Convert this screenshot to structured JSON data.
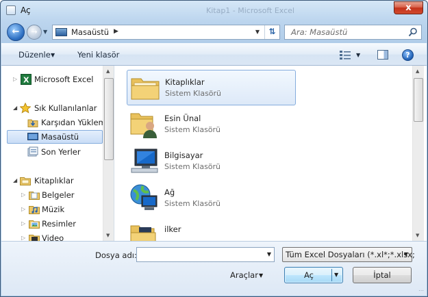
{
  "window": {
    "title": "Aç",
    "background_title": "Kitap1 - Microsoft Excel",
    "close_label": "x"
  },
  "nav": {
    "address": "Masaüstü",
    "search_placeholder": "Ara: Masaüstü"
  },
  "toolbar": {
    "organize_label": "Düzenle",
    "new_folder_label": "Yeni klasör",
    "help_label": "?"
  },
  "sidebar": {
    "items": [
      {
        "label": "Microsoft Excel",
        "icon": "excel-icon"
      },
      {
        "label": "Sık Kullanılanlar",
        "icon": "star-icon"
      },
      {
        "label": "Karşıdan Yüklemeler",
        "icon": "downloads-folder-icon"
      },
      {
        "label": "Masaüstü",
        "icon": "desktop-icon",
        "selected": true
      },
      {
        "label": "Son Yerler",
        "icon": "recent-places-icon"
      },
      {
        "label": "Kitaplıklar",
        "icon": "libraries-icon"
      },
      {
        "label": "Belgeler",
        "icon": "documents-icon"
      },
      {
        "label": "Müzik",
        "icon": "music-icon"
      },
      {
        "label": "Resimler",
        "icon": "pictures-icon"
      },
      {
        "label": "Video",
        "icon": "video-icon"
      }
    ]
  },
  "files": [
    {
      "name": "Kitaplıklar",
      "type": "Sistem Klasörü",
      "icon": "libraries-folder-icon",
      "selected": true
    },
    {
      "name": "Esin Ünal",
      "type": "Sistem Klasörü",
      "icon": "user-folder-icon"
    },
    {
      "name": "Bilgisayar",
      "type": "Sistem Klasörü",
      "icon": "computer-icon"
    },
    {
      "name": "Ağ",
      "type": "Sistem Klasörü",
      "icon": "network-icon"
    },
    {
      "name": "ilker",
      "type": "",
      "icon": "folder-icon"
    }
  ],
  "bottom": {
    "filename_label": "Dosya adı:",
    "filename_value": "",
    "filetype_value": "Tüm Excel Dosyaları (*.xl*;*.xlsx;",
    "tools_label": "Araçlar",
    "open_label": "Aç",
    "cancel_label": "İptal"
  },
  "colors": {
    "accent": "#3c7fb1",
    "selection_border": "#84acdd",
    "frame": "#a9c6e4"
  }
}
